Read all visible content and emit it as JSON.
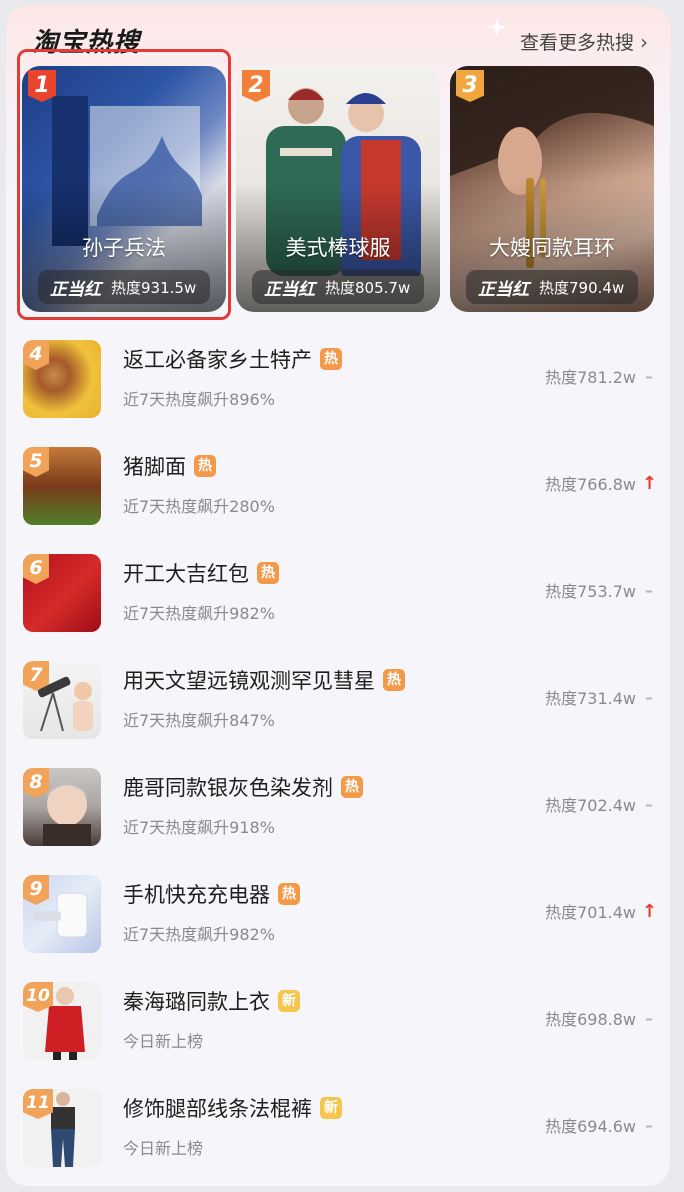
{
  "header": {
    "logo": "淘宝热搜",
    "more_label": "查看更多热搜"
  },
  "top3": [
    {
      "rank": "1",
      "name": "孙子兵法",
      "brand": "正当红",
      "heat": "热度931.5w",
      "rank_color": "#e8452c"
    },
    {
      "rank": "2",
      "name": "美式棒球服",
      "brand": "正当红",
      "heat": "热度805.7w",
      "rank_color": "#f0803a"
    },
    {
      "rank": "3",
      "name": "大嫂同款耳环",
      "brand": "正当红",
      "heat": "热度790.4w",
      "rank_color": "#f2a640"
    }
  ],
  "list": [
    {
      "rank": "4",
      "title": "返工必备家乡土特产",
      "tag": "热",
      "sub": "近7天热度飙升896%",
      "heat": "热度781.2w",
      "trend": "flat"
    },
    {
      "rank": "5",
      "title": "猪脚面",
      "tag": "热",
      "sub": "近7天热度飙升280%",
      "heat": "热度766.8w",
      "trend": "up"
    },
    {
      "rank": "6",
      "title": "开工大吉红包",
      "tag": "热",
      "sub": "近7天热度飙升982%",
      "heat": "热度753.7w",
      "trend": "flat"
    },
    {
      "rank": "7",
      "title": "用天文望远镜观测罕见彗星",
      "tag": "热",
      "sub": "近7天热度飙升847%",
      "heat": "热度731.4w",
      "trend": "flat"
    },
    {
      "rank": "8",
      "title": "鹿哥同款银灰色染发剂",
      "tag": "热",
      "sub": "近7天热度飙升918%",
      "heat": "热度702.4w",
      "trend": "flat"
    },
    {
      "rank": "9",
      "title": "手机快充充电器",
      "tag": "热",
      "sub": "近7天热度飙升982%",
      "heat": "热度701.4w",
      "trend": "up"
    },
    {
      "rank": "10",
      "title": "秦海璐同款上衣",
      "tag": "新",
      "sub": "今日新上榜",
      "heat": "热度698.8w",
      "trend": "flat"
    },
    {
      "rank": "11",
      "title": "修饰腿部线条法棍裤",
      "tag": "新",
      "sub": "今日新上榜",
      "heat": "热度694.6w",
      "trend": "flat"
    }
  ],
  "colors": {
    "highlight": "#e23c36",
    "hot_tag": "#f29a4a",
    "new_tag": "#f5c54c",
    "trend_up": "#ea3b2e"
  }
}
